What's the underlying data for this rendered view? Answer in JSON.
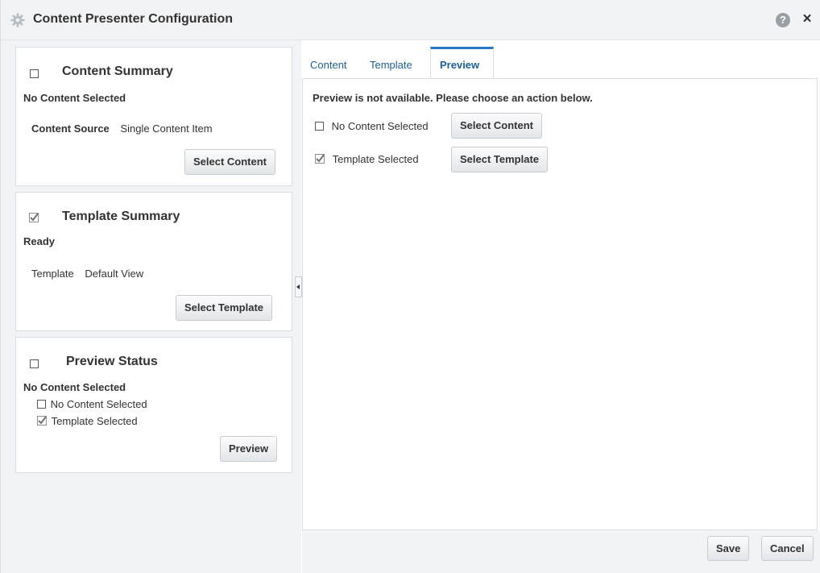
{
  "dialog": {
    "title": "Content Presenter Configuration",
    "help_icon": "help-circle-icon",
    "help_label": "?",
    "close_icon": "close-icon",
    "close_label": "×"
  },
  "content_summary": {
    "heading": "Content Summary",
    "status": "No Content Selected",
    "source_label": "Content Source",
    "source_value": "Single Content Item",
    "button": "Select Content"
  },
  "template_summary": {
    "heading": "Template Summary",
    "status": "Ready",
    "template_label": "Template",
    "template_value": "Default View",
    "button": "Select Template"
  },
  "preview_status": {
    "heading": "Preview Status",
    "status": "No Content Selected",
    "items": [
      "No Content Selected",
      "Template Selected"
    ],
    "button": "Preview"
  },
  "tabs": [
    {
      "label": "Content",
      "active": false
    },
    {
      "label": "Template",
      "active": false
    },
    {
      "label": "Preview",
      "active": true
    }
  ],
  "preview": {
    "message": "Preview is not available. Please choose an action below.",
    "content_row_label": "No Content Selected",
    "content_button": "Select Content",
    "template_row_label": "Template Selected",
    "template_button": "Select Template"
  },
  "footer": {
    "save": "Save",
    "cancel": "Cancel"
  },
  "colors": {
    "accent": "#2b76c4",
    "tab_text": "#1e5f95",
    "panel_bg": "#f2f3f4"
  }
}
